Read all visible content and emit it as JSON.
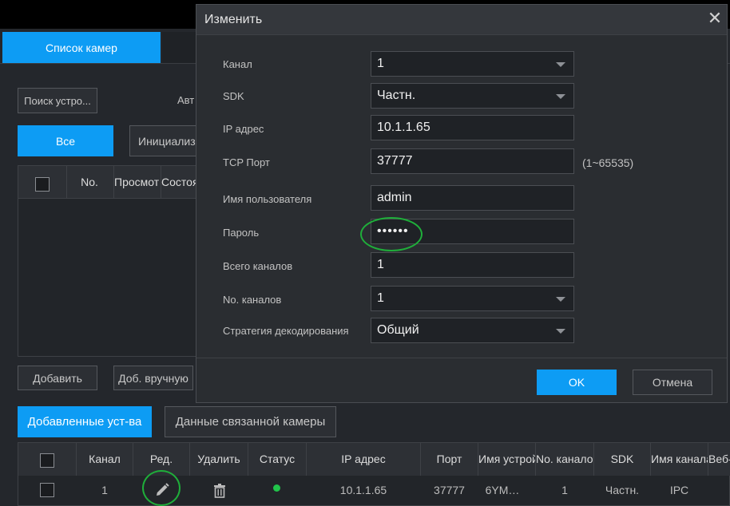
{
  "background": {
    "tab_camera_list": "Список камер",
    "search_button": "Поиск устро...",
    "auto_label": "Авт",
    "filter_all": "Все",
    "filter_init": "Инициализ",
    "grid1_headers": [
      "No.",
      "Просмот",
      "Состоя"
    ],
    "add_button": "Добавить",
    "add_manual_button": "Доб. вручную",
    "tab_added_devices": "Добавленные уст-ва",
    "tab_linked_camera": "Данные связанной камеры",
    "grid2_headers": [
      "Канал",
      "Ред.",
      "Удалить",
      "Статус",
      "IP адрес",
      "Порт",
      "Имя устрой",
      "No. канало",
      "SDK",
      "Имя канала",
      "Веб-"
    ],
    "row": {
      "channel": "1",
      "ip": "10.1.1.65",
      "port": "37777",
      "device_name": "6YM…",
      "channel_no": "1",
      "sdk": "Частн.",
      "channel_name": "IPC",
      "status_color": "#21c44a"
    }
  },
  "modal": {
    "title": "Изменить",
    "fields": [
      {
        "label": "Канал",
        "value": "1",
        "dropdown": true
      },
      {
        "label": "SDK",
        "value": "Частн.",
        "dropdown": true
      },
      {
        "label": "IP адрес",
        "value": "10.1.1.65",
        "dropdown": false
      },
      {
        "label": "TCP Порт",
        "value": "37777",
        "dropdown": false
      },
      {
        "label": "Имя пользователя",
        "value": "admin",
        "dropdown": false
      },
      {
        "label": "Пароль",
        "value": "••••••",
        "dropdown": false
      },
      {
        "label": "Всего каналов",
        "value": "1",
        "dropdown": false
      },
      {
        "label": "No. каналов",
        "value": "1",
        "dropdown": true
      },
      {
        "label": "Стратегия декодирования",
        "value": "Общий",
        "dropdown": true
      }
    ],
    "port_range_hint": "(1~65535)",
    "ok_label": "OK",
    "cancel_label": "Отмена",
    "accent_color": "#0d9cf4"
  }
}
